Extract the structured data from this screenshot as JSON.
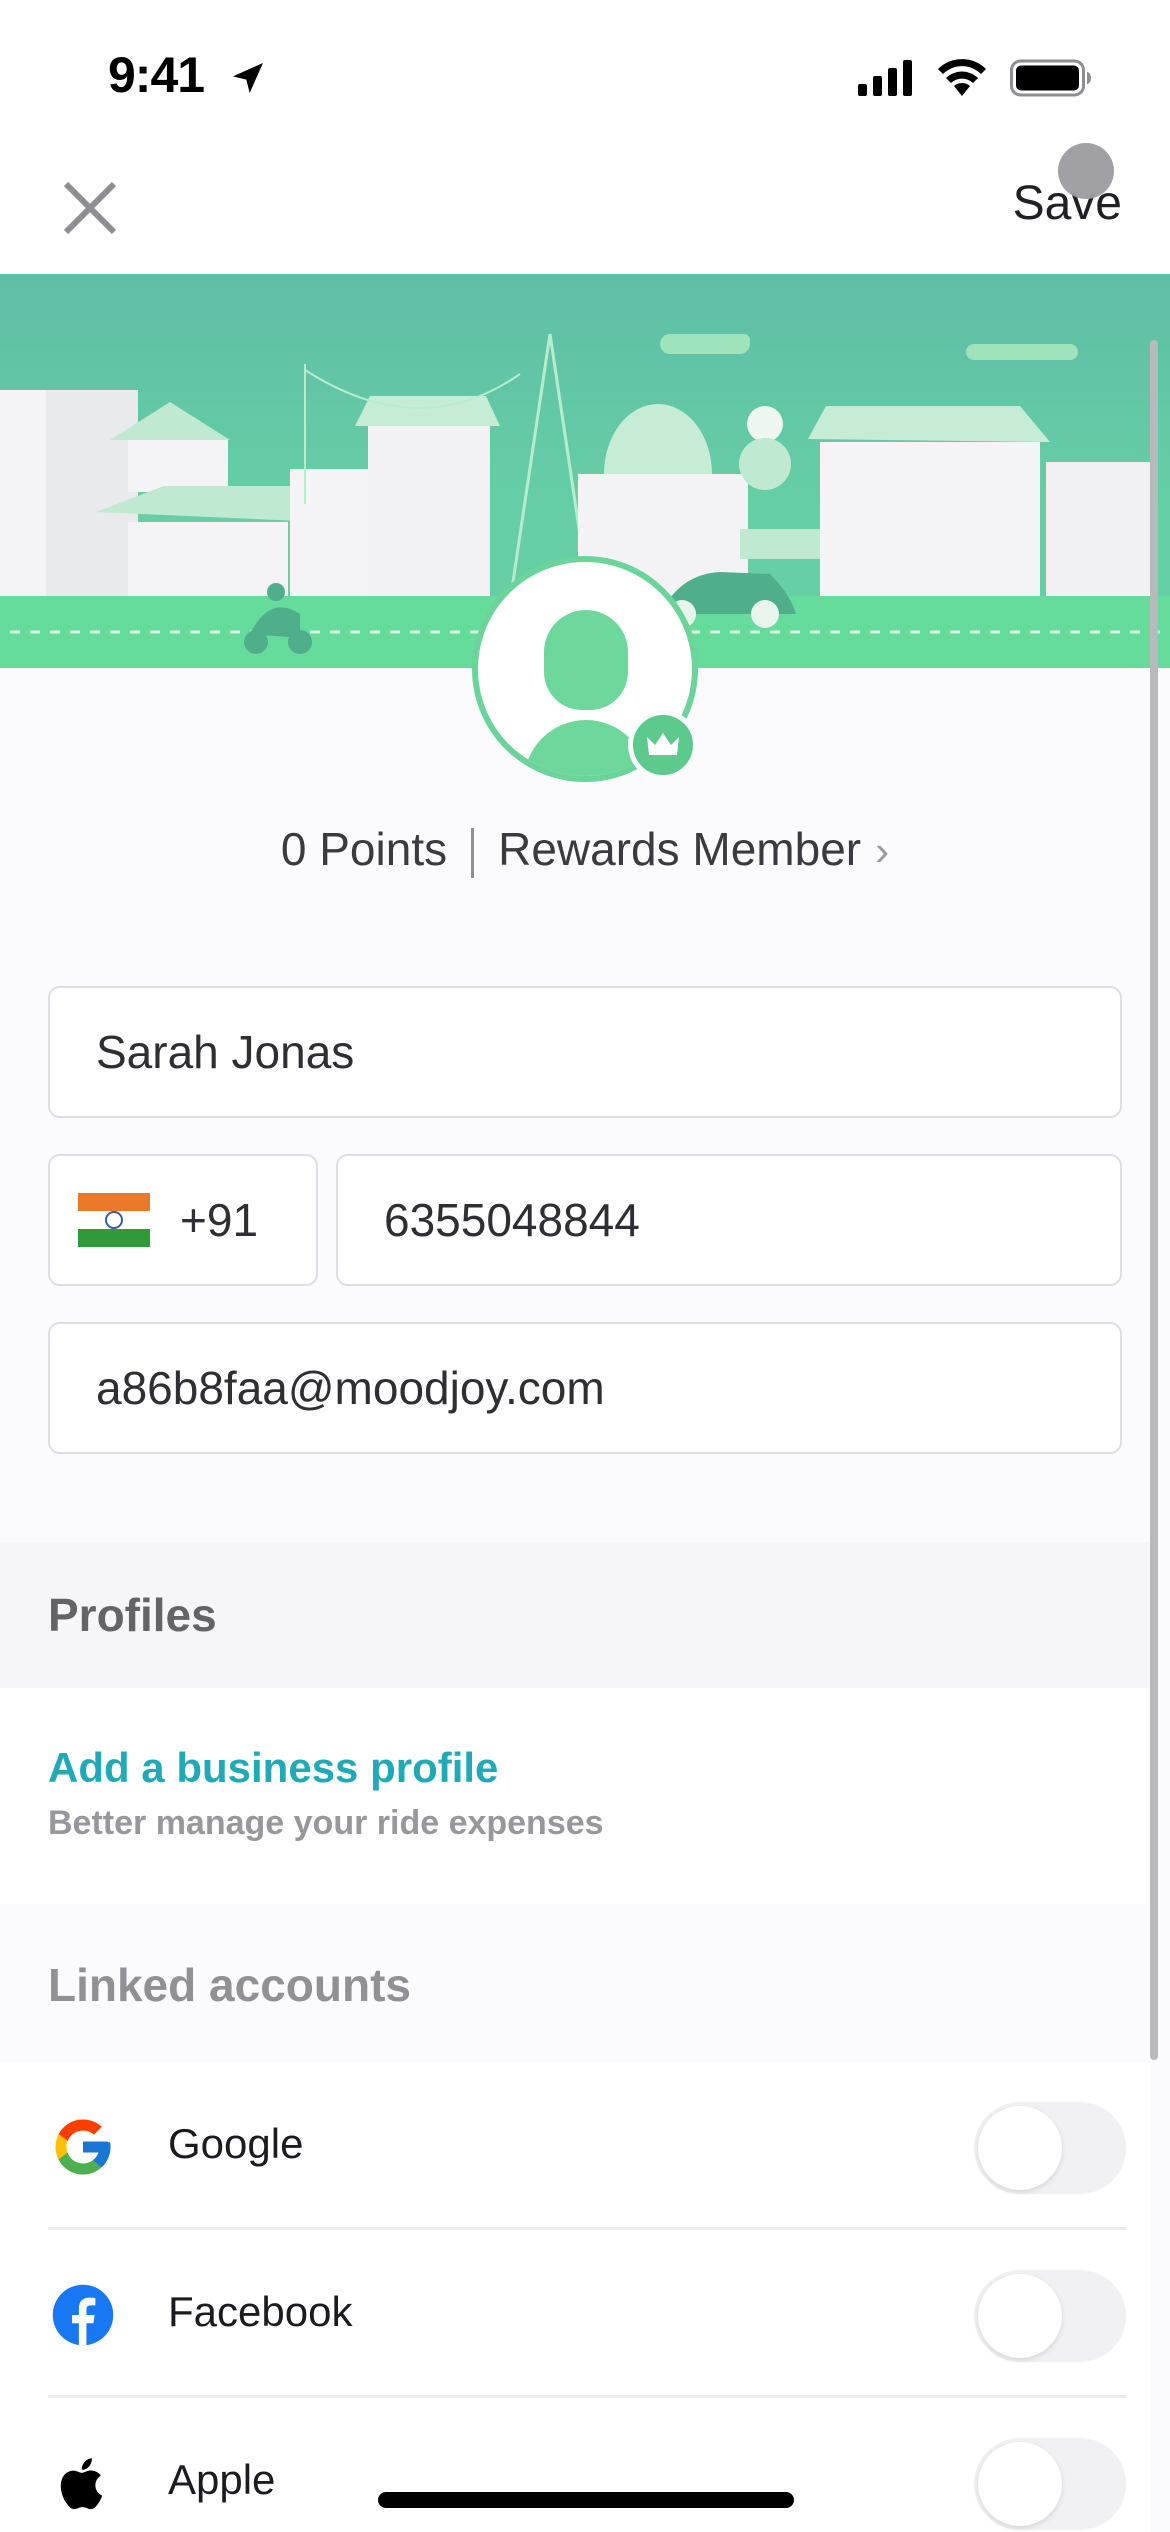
{
  "status_bar": {
    "time": "9:41"
  },
  "nav": {
    "save_label": "Save"
  },
  "rewards": {
    "points": "0 Points",
    "tier": "Rewards Member",
    "chevron": "›"
  },
  "form": {
    "name": "Sarah Jonas",
    "country_code": "+91",
    "country_flag": "India",
    "phone": "6355048844",
    "email": "a86b8faa@moodjoy.com"
  },
  "profiles": {
    "header": "Profiles",
    "add_business_title": "Add a business profile",
    "add_business_subtitle": "Better manage your ride expenses"
  },
  "linked_accounts": {
    "header": "Linked accounts",
    "items": [
      {
        "name": "Google",
        "icon": "google-icon",
        "linked": false
      },
      {
        "name": "Facebook",
        "icon": "facebook-icon",
        "linked": false
      },
      {
        "name": "Apple",
        "icon": "apple-icon",
        "linked": false
      }
    ]
  },
  "colors": {
    "brand_green": "#6ad49a",
    "link_teal": "#21a9b8",
    "banner_sky": "#5fbea7"
  }
}
